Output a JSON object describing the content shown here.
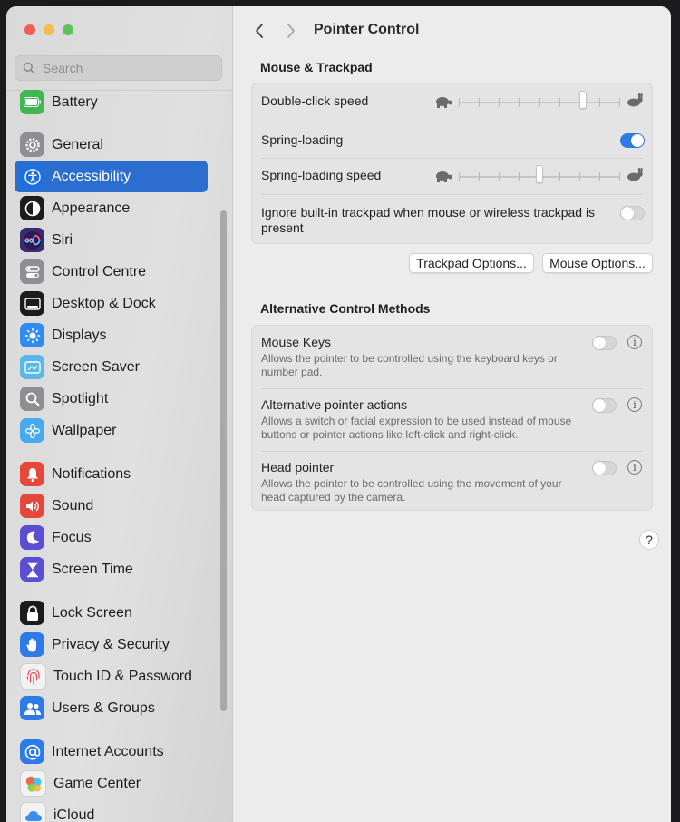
{
  "colors": {
    "accent": "#2c6ecf",
    "toggle_on": "#2f7be6"
  },
  "sidebar": {
    "search_placeholder": "Search",
    "items": [
      {
        "label": "Battery",
        "icon": "battery-icon",
        "color": "#3fb94f"
      },
      {
        "label": "General",
        "icon": "gear-icon",
        "color": "#8e8e93"
      },
      {
        "label": "Accessibility",
        "icon": "accessibility-icon",
        "color": "#1e6fe0",
        "selected": true
      },
      {
        "label": "Appearance",
        "icon": "appearance-icon",
        "color": "#1c1c1e"
      },
      {
        "label": "Siri",
        "icon": "siri-icon",
        "color": "#3a2a6e"
      },
      {
        "label": "Control Centre",
        "icon": "control-centre-icon",
        "color": "#8e8e93"
      },
      {
        "label": "Desktop & Dock",
        "icon": "dock-icon",
        "color": "#1c1c1e"
      },
      {
        "label": "Displays",
        "icon": "displays-icon",
        "color": "#2f8cf0"
      },
      {
        "label": "Screen Saver",
        "icon": "screen-saver-icon",
        "color": "#59b8e8"
      },
      {
        "label": "Spotlight",
        "icon": "spotlight-icon",
        "color": "#8e8e93"
      },
      {
        "label": "Wallpaper",
        "icon": "wallpaper-icon",
        "color": "#47a9ee"
      },
      {
        "label": "Notifications",
        "icon": "notifications-icon",
        "color": "#e5483a"
      },
      {
        "label": "Sound",
        "icon": "sound-icon",
        "color": "#e5483a"
      },
      {
        "label": "Focus",
        "icon": "focus-icon",
        "color": "#5a4fd1"
      },
      {
        "label": "Screen Time",
        "icon": "screen-time-icon",
        "color": "#5a4fd1"
      },
      {
        "label": "Lock Screen",
        "icon": "lock-icon",
        "color": "#1c1c1e"
      },
      {
        "label": "Privacy & Security",
        "icon": "privacy-hand-icon",
        "color": "#2f7be6"
      },
      {
        "label": "Touch ID & Password",
        "icon": "fingerprint-icon",
        "color": "#f2f2f2"
      },
      {
        "label": "Users & Groups",
        "icon": "users-icon",
        "color": "#2f7be6"
      },
      {
        "label": "Internet Accounts",
        "icon": "at-sign-icon",
        "color": "#2f7be6"
      },
      {
        "label": "Game Center",
        "icon": "game-center-icon",
        "color": "#f2f2f2"
      },
      {
        "label": "iCloud",
        "icon": "icloud-icon",
        "color": "#f2f2f2"
      }
    ]
  },
  "header": {
    "title": "Pointer Control"
  },
  "mouse_trackpad": {
    "title": "Mouse & Trackpad",
    "double_click_label": "Double-click speed",
    "double_click_level": 0.78,
    "spring_loading_label": "Spring-loading",
    "spring_loading_on": true,
    "spring_speed_label": "Spring-loading speed",
    "spring_speed_level": 0.5,
    "ignore_trackpad_label": "Ignore built-in trackpad when mouse or wireless trackpad is present",
    "ignore_trackpad_on": false,
    "trackpad_options_button": "Trackpad Options...",
    "mouse_options_button": "Mouse Options..."
  },
  "alternative": {
    "title": "Alternative Control Methods",
    "items": [
      {
        "label": "Mouse Keys",
        "desc": "Allows the pointer to be controlled using the keyboard keys or number pad.",
        "on": false
      },
      {
        "label": "Alternative pointer actions",
        "desc": "Allows a switch or facial expression to be used instead of mouse buttons or pointer actions like left-click and right-click.",
        "on": false
      },
      {
        "label": "Head pointer",
        "desc": "Allows the pointer to be controlled using the movement of your head captured by the camera.",
        "on": false
      }
    ]
  },
  "info_glyph": "i",
  "help_label": "?"
}
